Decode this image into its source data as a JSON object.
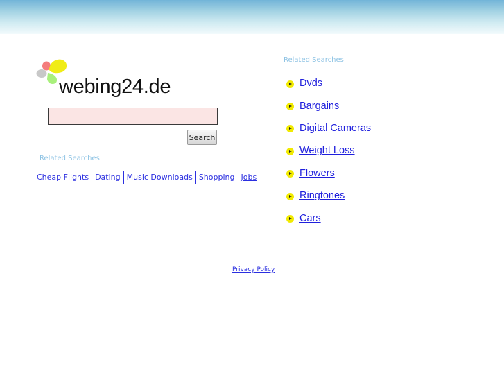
{
  "header": {
    "accent_gradient": [
      "#72b4d8",
      "#f2fafc"
    ]
  },
  "logo": {
    "text": "webing24.de",
    "petal_colors": {
      "red": "#f47c7c",
      "yellow": "#f0ec16",
      "gray": "#c8c8c8",
      "green": "#a9f07c"
    }
  },
  "search": {
    "input_value": "",
    "input_placeholder": "",
    "button_label": "Search"
  },
  "left_related": {
    "title": "Related Searches",
    "links": [
      "Cheap Flights",
      "Dating",
      "Music Downloads",
      "Shopping",
      "Jobs"
    ]
  },
  "right_related": {
    "title": "Related Searches",
    "links": [
      "Dvds",
      "Bargains",
      "Digital Cameras",
      "Weight Loss",
      "Flowers",
      "Ringtones",
      "Cars"
    ]
  },
  "footer": {
    "privacy_label": "Privacy Policy"
  }
}
